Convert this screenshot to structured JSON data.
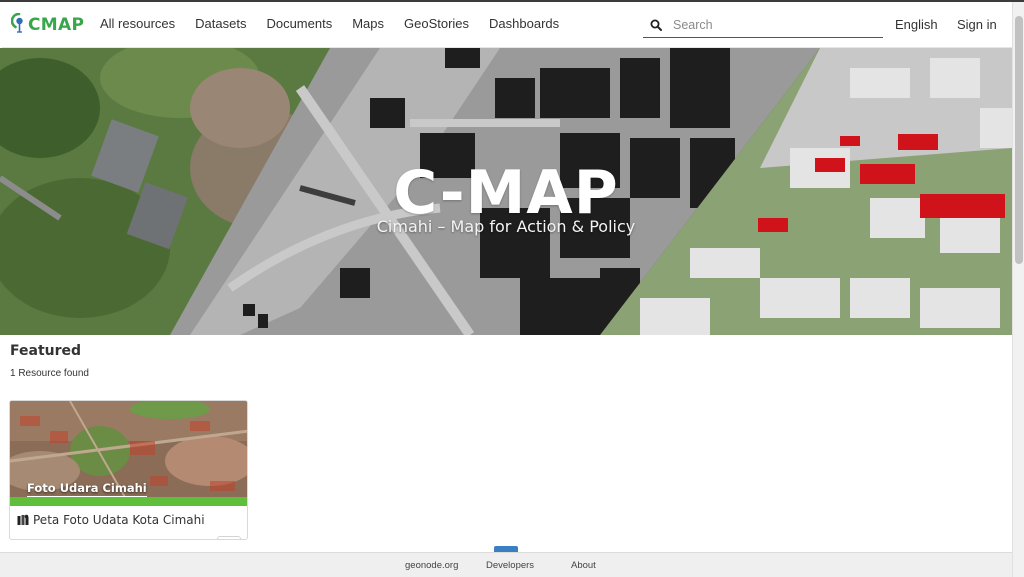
{
  "header": {
    "logo_text": "CMAP",
    "nav": [
      "All resources",
      "Datasets",
      "Documents",
      "Maps",
      "GeoStories",
      "Dashboards"
    ],
    "search_placeholder": "Search",
    "language": "English",
    "sign_in": "Sign in"
  },
  "hero": {
    "title": "C-MAP",
    "subtitle": "Cimahi – Map for Action & Policy"
  },
  "featured": {
    "title": "Featured",
    "count": "1 Resource found",
    "cards": [
      {
        "thumb_label": "Foto Udara Cimahi",
        "title": "Peta Foto Udata Kota Cimahi",
        "icon": "map-icon"
      }
    ]
  },
  "footer": {
    "links": [
      "geonode.org",
      "Developers",
      "About"
    ]
  },
  "colors": {
    "brand_green": "#3aa64b",
    "accent_blue": "#3a7fc1",
    "roof_red": "#d0121a"
  }
}
